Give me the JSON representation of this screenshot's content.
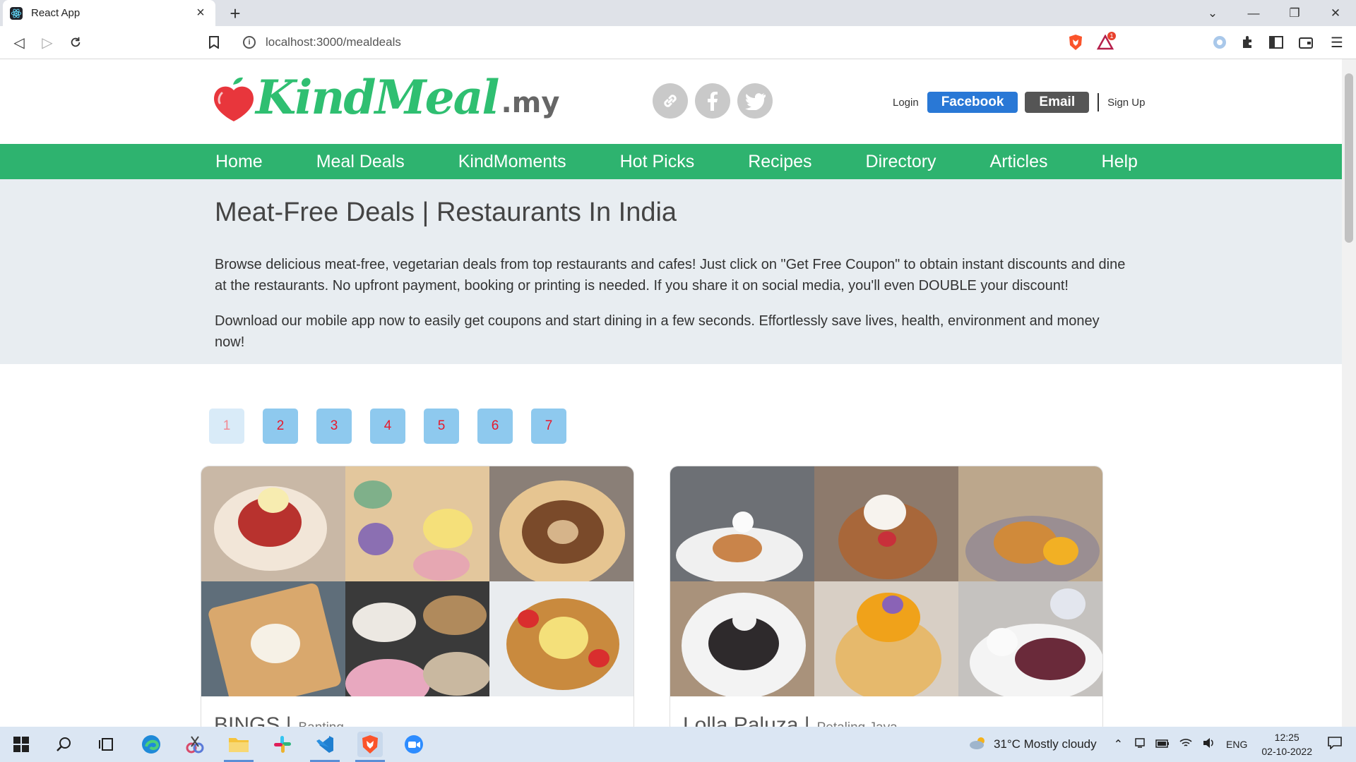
{
  "browser": {
    "tab_title": "React App",
    "url": "localhost:3000/mealdeals",
    "window_controls": [
      "minimize",
      "maximize",
      "close"
    ],
    "brave_badge": "1"
  },
  "site": {
    "logo_text": "KindMeal",
    "logo_tld": ".my",
    "socials": [
      "link-icon",
      "facebook-icon",
      "twitter-icon"
    ],
    "login_label": "Login",
    "facebook_label": "Facebook",
    "email_label": "Email",
    "signup_label": "Sign Up"
  },
  "nav": {
    "items": [
      "Home",
      "Meal Deals",
      "KindMoments",
      "Hot Picks",
      "Recipes",
      "Directory",
      "Articles",
      "Help"
    ],
    "color": "#2eb36f"
  },
  "intro": {
    "title": "Meat-Free Deals | Restaurants In India",
    "paragraph1": "Browse delicious meat-free, vegetarian deals from top restaurants and cafes! Just click on \"Get Free Coupon\" to obtain instant discounts and dine at the restaurants. No upfront payment, booking or printing is needed. If you share it on social media, you'll even DOUBLE your discount!",
    "paragraph2": "Download our mobile app now to easily get coupons and start dining in a few seconds. Effortlessly save lives, health, environment and money now!"
  },
  "pagination": {
    "pages": [
      "1",
      "2",
      "3",
      "4",
      "5",
      "6",
      "7"
    ],
    "active": "1"
  },
  "deals": [
    {
      "name": "BINGS |",
      "location": "Banting"
    },
    {
      "name": "Lolla Paluza |",
      "location": "Petaling Jaya"
    }
  ],
  "taskbar": {
    "weather": "31°C  Mostly cloudy",
    "lang": "ENG",
    "time": "12:25",
    "date": "02-10-2022"
  }
}
